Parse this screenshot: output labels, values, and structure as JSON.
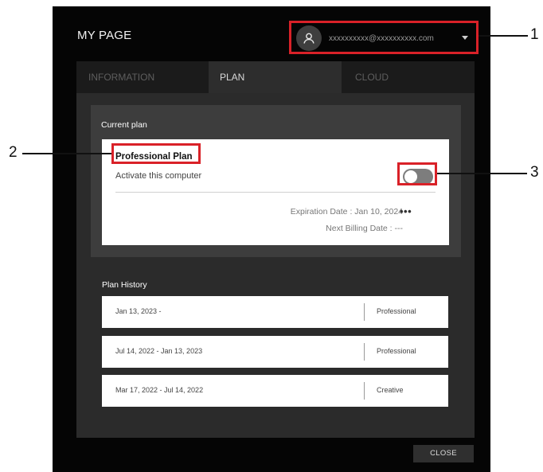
{
  "dialog": {
    "title": "MY PAGE",
    "account_email": "xxxxxxxxxx@xxxxxxxxxx.com"
  },
  "tabs": [
    {
      "label": "INFORMATION",
      "active": false
    },
    {
      "label": "PLAN",
      "active": true
    },
    {
      "label": "CLOUD",
      "active": false
    }
  ],
  "current_plan": {
    "section_label": "Current plan",
    "plan_name": "Professional Plan",
    "activate_label": "Activate this computer",
    "activate_on": false,
    "expiration": "Expiration Date : Jan 10, 2024",
    "next_billing": "Next Billing Date : ---",
    "more_label": "•••"
  },
  "plan_history": {
    "section_label": "Plan History",
    "rows": [
      {
        "period": "Jan 13, 2023 -",
        "plan": "Professional"
      },
      {
        "period": "Jul 14, 2022 - Jan 13, 2023",
        "plan": "Professional"
      },
      {
        "period": "Mar 17, 2022 - Jul 14, 2022",
        "plan": "Creative"
      }
    ]
  },
  "footer": {
    "close_label": "CLOSE"
  },
  "callouts": [
    "1",
    "2",
    "3"
  ],
  "colors": {
    "callout": "#d92128",
    "dialog_bg": "#050505",
    "panel_bg": "#2b2b2b",
    "active_tab": "#2d2d2d"
  },
  "icons": {
    "avatar": "user-icon",
    "account_menu": "caret-down-icon",
    "more": "more-horizontal-icon"
  }
}
